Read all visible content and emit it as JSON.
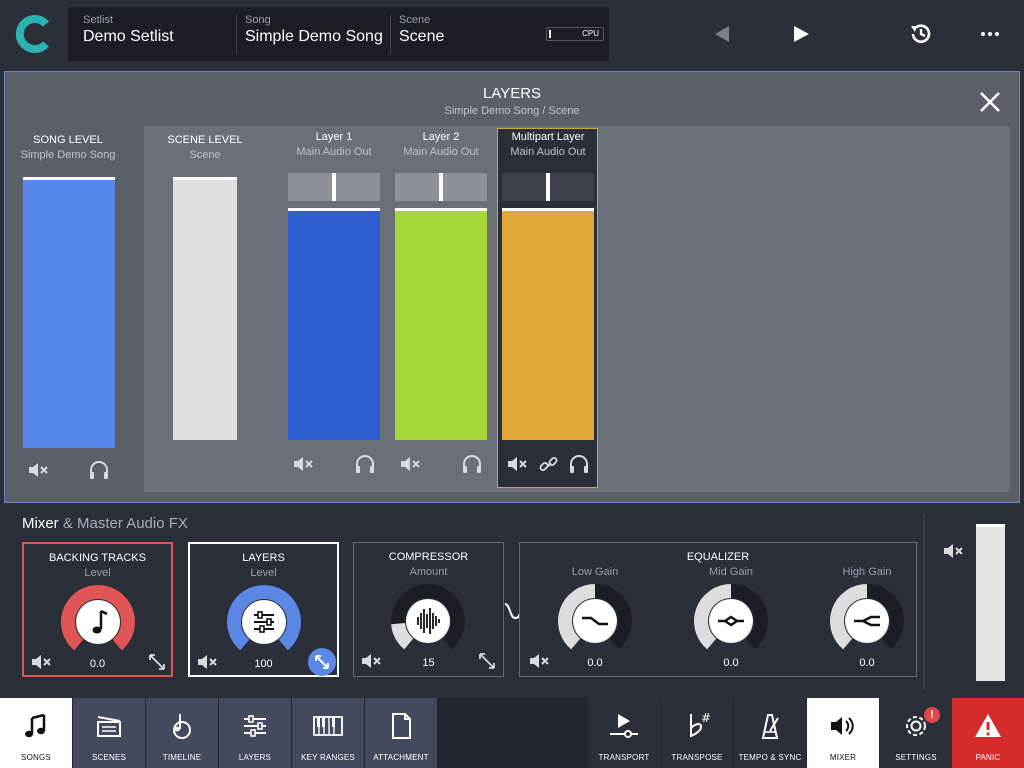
{
  "topbar": {
    "setlist_label": "Setlist",
    "setlist_value": "Demo Setlist",
    "song_label": "Song",
    "song_value": "Simple Demo Song",
    "scene_label": "Scene",
    "scene_value": "Scene",
    "cpu_label": "CPU",
    "cpu_usage": 0.03
  },
  "layers_panel": {
    "title": "LAYERS",
    "subtitle": "Simple Demo Song / Scene",
    "song_level": {
      "title": "SONG LEVEL",
      "subtitle": "Simple Demo Song"
    },
    "scene_level": {
      "title": "SCENE LEVEL",
      "subtitle": "Scene"
    },
    "layers": [
      {
        "title": "Layer 1",
        "subtitle": "Main Audio Out",
        "color": "#2f5fd0",
        "pan": 0.5
      },
      {
        "title": "Layer 2",
        "subtitle": "Main Audio Out",
        "color": "#a5d63a",
        "pan": 0.5
      },
      {
        "title": "Multipart Layer",
        "subtitle": "Main Audio Out",
        "color": "#e0a73a",
        "pan": 0.5
      }
    ],
    "colors": {
      "song_level": "#5588e8",
      "scene_level": "#e0e0e0",
      "selection_border": "#d4a53a"
    }
  },
  "mixer": {
    "title": "Mixer",
    "subtitle": "& Master Audio FX",
    "fx": [
      {
        "name": "BACKING TRACKS",
        "param": "Level",
        "value": "0.0",
        "icon": "music-note-icon",
        "color": "#e05555"
      },
      {
        "name": "LAYERS",
        "param": "Level",
        "value": "100",
        "icon": "sliders-icon",
        "color": "#5b87e6"
      },
      {
        "name": "COMPRESSOR",
        "param": "Amount",
        "value": "15",
        "icon": "waveform-icon",
        "color": "#dddddd"
      }
    ],
    "equalizer": {
      "name": "EQUALIZER",
      "bands": [
        {
          "param": "Low Gain",
          "value": "0.0"
        },
        {
          "param": "Mid Gain",
          "value": "0.0"
        },
        {
          "param": "High Gain",
          "value": "0.0"
        }
      ]
    }
  },
  "nav": {
    "left": [
      {
        "label": "SONGS",
        "active": true
      },
      {
        "label": "SCENES"
      },
      {
        "label": "TIMELINE"
      },
      {
        "label": "LAYERS"
      },
      {
        "label": "KEY RANGES"
      },
      {
        "label": "ATTACHMENT"
      }
    ],
    "right": [
      {
        "label": "TRANSPORT"
      },
      {
        "label": "TRANSPOSE"
      },
      {
        "label": "TEMPO & SYNC"
      },
      {
        "label": "MIXER",
        "active": true
      },
      {
        "label": "SETTINGS",
        "badge": "!"
      },
      {
        "label": "PANIC"
      }
    ],
    "colors": {
      "panic": "#d42b2b",
      "badge": "#e04848",
      "highlight": "#434a5e"
    }
  }
}
